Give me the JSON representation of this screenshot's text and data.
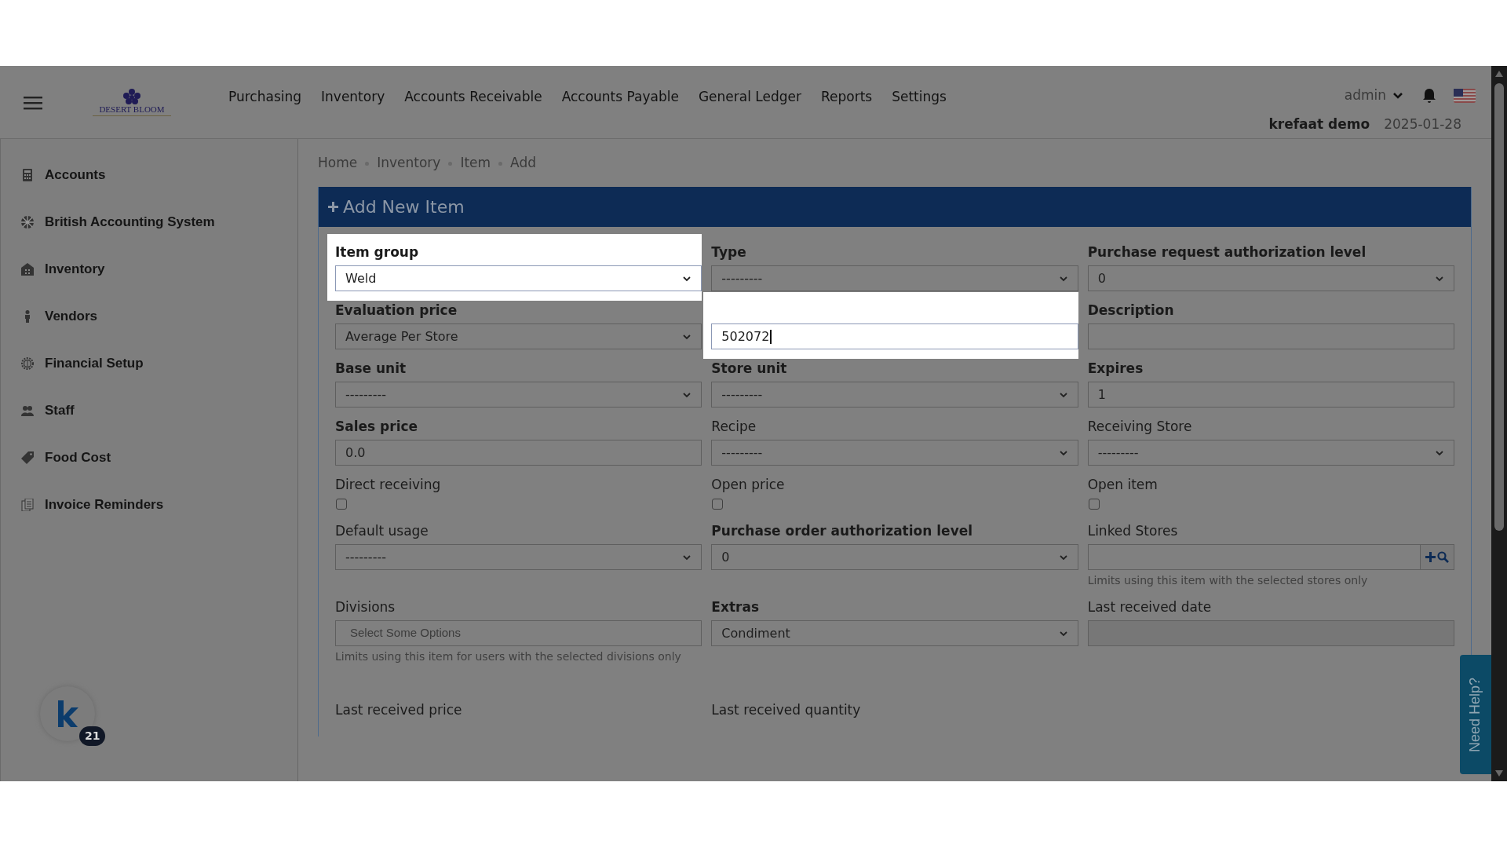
{
  "header": {
    "logo": {
      "name": "DESERT BLOOM"
    },
    "nav": [
      {
        "label": "Purchasing"
      },
      {
        "label": "Inventory"
      },
      {
        "label": "Accounts Receivable"
      },
      {
        "label": "Accounts Payable"
      },
      {
        "label": "General Ledger"
      },
      {
        "label": "Reports"
      },
      {
        "label": "Settings"
      }
    ],
    "user": "admin",
    "company": "krefaat demo",
    "date": "2025-01-28"
  },
  "sidebar": {
    "items": [
      {
        "label": "Accounts"
      },
      {
        "label": "British Accounting System"
      },
      {
        "label": "Inventory"
      },
      {
        "label": "Vendors"
      },
      {
        "label": "Financial Setup"
      },
      {
        "label": "Staff"
      },
      {
        "label": "Food Cost"
      },
      {
        "label": "Invoice Reminders"
      }
    ],
    "chat": {
      "badge": "21"
    }
  },
  "breadcrumb": [
    "Home",
    "Inventory",
    "Item",
    "Add"
  ],
  "panel": {
    "title": "Add New Item"
  },
  "fields": [
    {
      "label": "Item group",
      "bold": true,
      "kind": "select",
      "value": "Weld",
      "highlighted": true
    },
    {
      "label": "Type",
      "bold": true,
      "kind": "select",
      "value": "---------",
      "highlighted": false
    },
    {
      "label": "Purchase request authorization level",
      "bold": true,
      "kind": "select",
      "value": "0",
      "highlighted": false
    },
    {
      "label": "Evaluation price",
      "bold": true,
      "kind": "select",
      "value": "Average Per Store",
      "highlighted": false
    },
    {
      "kind": "text",
      "value": "502072",
      "focused": true,
      "highlighted": true
    },
    {
      "label": "Description",
      "bold": true,
      "kind": "text",
      "highlighted": false
    },
    {
      "label": "Base unit",
      "bold": true,
      "kind": "select",
      "value": "---------",
      "highlighted": false
    },
    {
      "label": "Store unit",
      "bold": true,
      "kind": "select",
      "value": "---------",
      "highlighted": false
    },
    {
      "label": "Expires",
      "bold": true,
      "kind": "text",
      "value": "1",
      "highlighted": false
    },
    {
      "label": "Sales price",
      "bold": true,
      "kind": "text",
      "value": "0.0",
      "highlighted": false
    },
    {
      "label": "Recipe",
      "bold": false,
      "kind": "select",
      "value": "---------",
      "highlighted": false
    },
    {
      "label": "Receiving Store",
      "bold": false,
      "kind": "select",
      "value": "---------",
      "highlighted": false
    },
    {
      "label": "Direct receiving",
      "bold": false,
      "kind": "checkbox",
      "checked": false,
      "highlighted": false
    },
    {
      "label": "Open price",
      "bold": false,
      "kind": "checkbox",
      "checked": false,
      "highlighted": false
    },
    {
      "label": "Open item",
      "bold": false,
      "kind": "checkbox",
      "checked": false,
      "highlighted": false
    },
    {
      "label": "Default usage",
      "bold": false,
      "kind": "select",
      "value": "---------",
      "highlighted": false
    },
    {
      "label": "Purchase order authorization level",
      "bold": true,
      "kind": "select",
      "value": "0",
      "highlighted": false
    },
    {
      "label": "Linked Stores",
      "bold": false,
      "kind": "search",
      "help": "Limits using this item with the selected stores only",
      "highlighted": false
    },
    {
      "label": "Divisions",
      "bold": false,
      "kind": "multiselect",
      "placeholder": "Select Some Options",
      "help": "Limits using this item for users with the selected divisions only",
      "highlighted": false
    },
    {
      "label": "Extras",
      "bold": true,
      "kind": "select",
      "value": "Condiment",
      "highlighted": false
    },
    {
      "label": "Last received date",
      "bold": false,
      "kind": "disabled",
      "highlighted": false
    },
    {
      "label": "Last received price",
      "bold": false,
      "kind": "label",
      "highlighted": false
    },
    {
      "label": "Last received quantity",
      "bold": false,
      "kind": "label",
      "highlighted": false
    }
  ],
  "help_tab": {
    "label": "Need Help?"
  }
}
